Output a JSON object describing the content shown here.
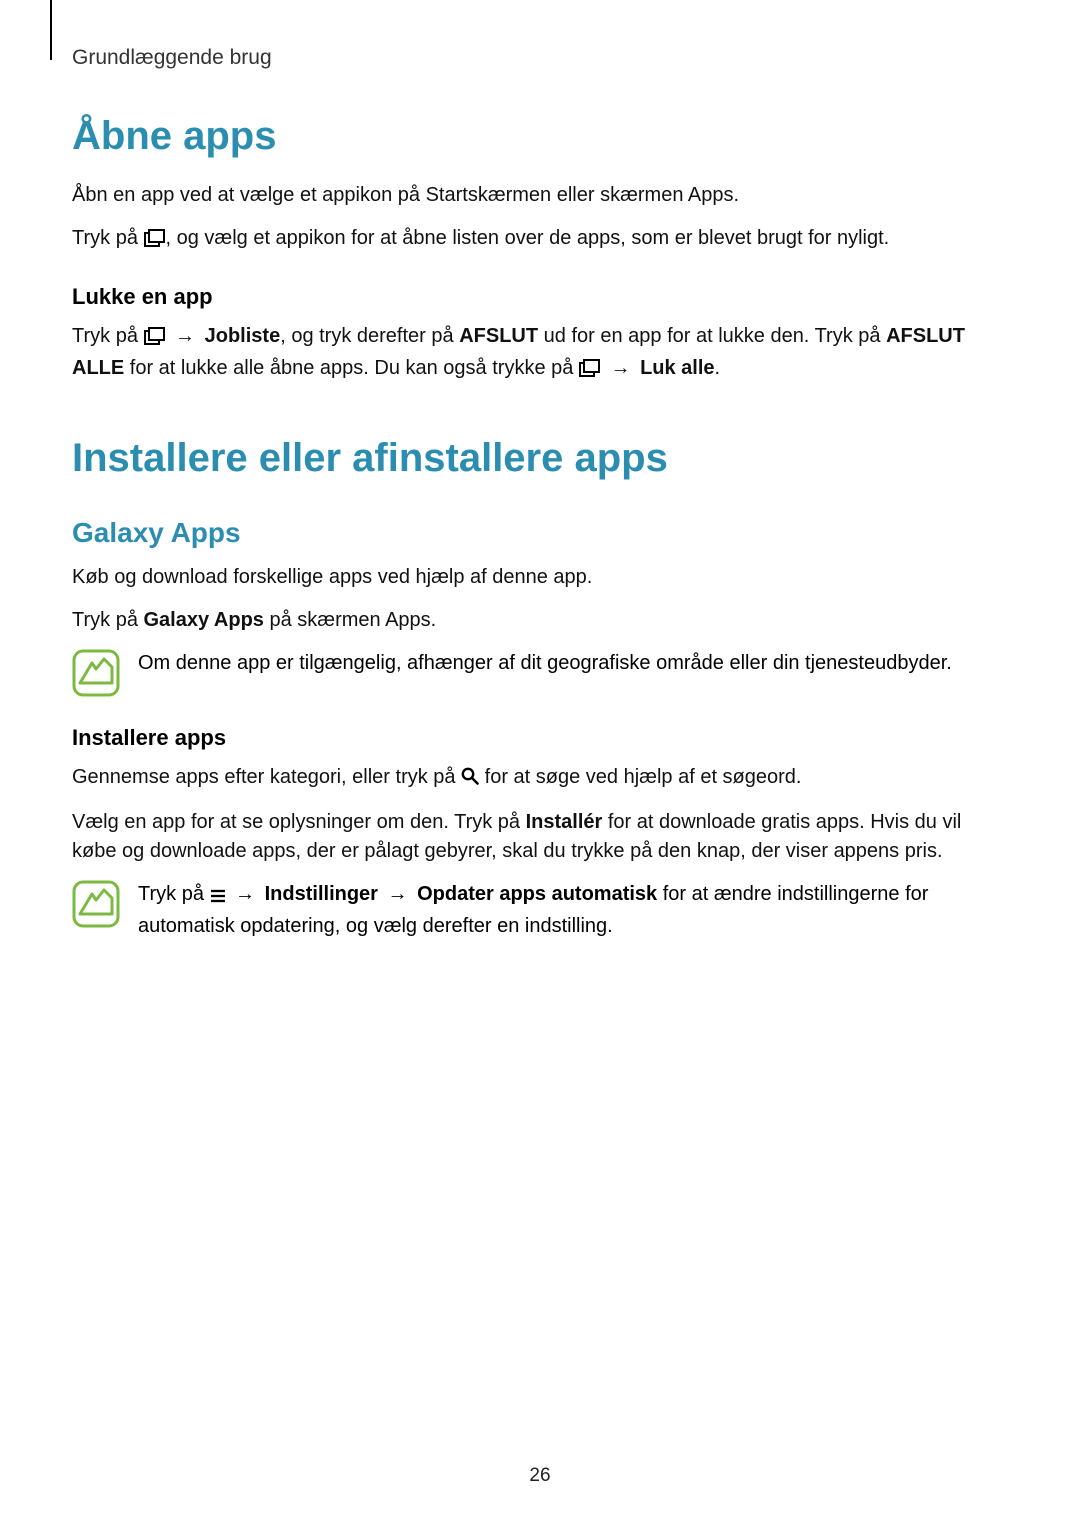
{
  "chapter": "Grundlæggende brug",
  "section1": {
    "title": "Åbne apps",
    "p1": "Åbn en app ved at vælge et appikon på Startskærmen eller skærmen Apps.",
    "p2_a": "Tryk på ",
    "p2_b": ", og vælg et appikon for at åbne listen over de apps, som er blevet brugt for nyligt.",
    "sub1": {
      "title": "Lukke en app",
      "p1_a": "Tryk på ",
      "p1_b": " → ",
      "p1_bold1": "Jobliste",
      "p1_c": ", og tryk derefter på ",
      "p1_bold2": "AFSLUT",
      "p1_d": " ud for en app for at lukke den. Tryk på ",
      "p1_bold3": "AFSLUT ALLE",
      "p1_e": " for at lukke alle åbne apps. Du kan også trykke på ",
      "p1_f": " → ",
      "p1_bold4": "Luk alle",
      "p1_g": "."
    }
  },
  "section2": {
    "title": "Installere eller afinstallere apps",
    "sub1": {
      "title": "Galaxy Apps",
      "p1": "Køb og download forskellige apps ved hjælp af denne app.",
      "p2_a": "Tryk på ",
      "p2_bold1": "Galaxy Apps",
      "p2_b": " på skærmen Apps.",
      "note1": "Om denne app er tilgængelig, afhænger af dit geografiske område eller din tjenesteudbyder.",
      "subsub1": {
        "title": "Installere apps",
        "p1_a": "Gennemse apps efter kategori, eller tryk på ",
        "p1_b": " for at søge ved hjælp af et søgeord.",
        "p2_a": "Vælg en app for at se oplysninger om den. Tryk på ",
        "p2_bold1": "Installér",
        "p2_b": " for at downloade gratis apps. Hvis du vil købe og downloade apps, der er pålagt gebyrer, skal du trykke på den knap, der viser appens pris.",
        "note2_a": "Tryk på ",
        "note2_b": " → ",
        "note2_bold1": "Indstillinger",
        "note2_c": " → ",
        "note2_bold2": "Opdater apps automatisk",
        "note2_d": " for at ændre indstillingerne for automatisk opdatering, og vælg derefter en indstilling."
      }
    }
  },
  "pageNumber": "26"
}
